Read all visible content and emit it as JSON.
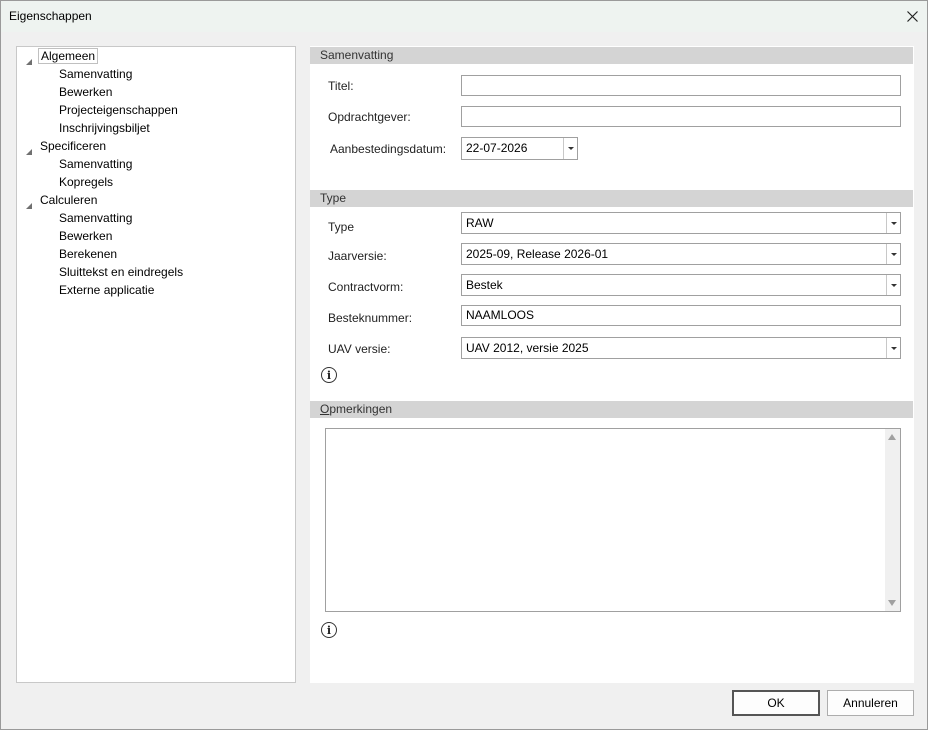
{
  "window": {
    "title": "Eigenschappen",
    "close_icon": "close-icon"
  },
  "tree": {
    "groups": [
      {
        "label": "Algemeen",
        "items": [
          "Samenvatting",
          "Bewerken",
          "Projecteigenschappen",
          "Inschrijvingsbiljet"
        ]
      },
      {
        "label": "Specificeren",
        "items": [
          "Samenvatting",
          "Kopregels"
        ]
      },
      {
        "label": "Calculeren",
        "items": [
          "Samenvatting",
          "Bewerken",
          "Berekenen",
          "Sluittekst en eindregels",
          "Externe applicatie"
        ]
      }
    ],
    "selected": "Algemeen"
  },
  "samenvatting": {
    "header": "Samenvatting",
    "titel_label": "Titel:",
    "titel_value": "",
    "opdrachtgever_label": "Opdrachtgever:",
    "opdrachtgever_value": "",
    "datum_label": "Aanbestedingsdatum:",
    "datum_value": "22-07-2026"
  },
  "type": {
    "header": "Type",
    "type_label": "Type",
    "type_value": "RAW",
    "jaarversie_label": "Jaarversie:",
    "jaarversie_value": "2025-09, Release 2026-01",
    "contractvorm_label": "Contractvorm:",
    "contractvorm_value": "Bestek",
    "besteknummer_label": "Besteknummer:",
    "besteknummer_value": "NAAMLOOS",
    "uav_label": "UAV versie:",
    "uav_value": "UAV 2012, versie 2025",
    "info_icon": "info-icon"
  },
  "opmerkingen": {
    "header_first": "O",
    "header_rest": "pmerkingen",
    "value": "",
    "info_icon": "info-icon"
  },
  "buttons": {
    "ok": "OK",
    "cancel": "Annuleren"
  }
}
